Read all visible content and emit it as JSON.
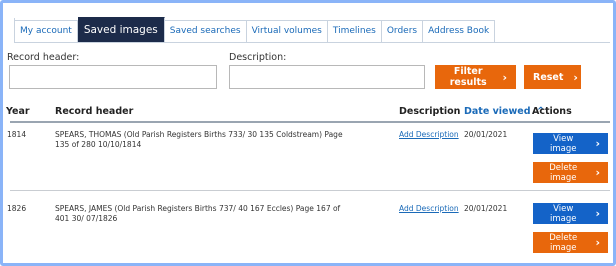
{
  "tabs": [
    {
      "label": "My account"
    },
    {
      "label": "Saved images",
      "active": true
    },
    {
      "label": "Saved searches"
    },
    {
      "label": "Virtual volumes"
    },
    {
      "label": "Timelines"
    },
    {
      "label": "Orders"
    },
    {
      "label": "Address Book"
    }
  ],
  "filters": {
    "record_header_label": "Record header:",
    "record_header_value": "",
    "description_label": "Description:",
    "description_value": "",
    "filter_label": "Filter results",
    "reset_label": "Reset"
  },
  "table": {
    "columns": {
      "year": "Year",
      "record_header": "Record header",
      "description": "Description",
      "date_viewed": "Date viewed",
      "actions": "Actions"
    },
    "sort_indicator": "^",
    "rows": [
      {
        "year": "1814",
        "record_header": "SPEARS, THOMAS (Old Parish Registers Births 733/  30 135 Coldstream) Page 135 of 280 10/10/1814",
        "description_link": "Add Description",
        "date_viewed": "20/01/2021",
        "view_label": "View image",
        "delete_label": "Delete image"
      },
      {
        "year": "1826",
        "record_header": "SPEARS, JAMES (Old Parish Registers Births 737/  40 167 Eccles) Page 167 of 401 30/ 07/1826",
        "description_link": "Add Description",
        "date_viewed": "20/01/2021",
        "view_label": "View image",
        "delete_label": "Delete image"
      }
    ]
  },
  "colors": {
    "accent_orange": "#e8670c",
    "accent_blue": "#1463c8",
    "active_tab": "#1c2b4a",
    "link": "#1a6ab8"
  },
  "icons": {
    "button_chevron": "chevron-right-icon",
    "sort": "sort-ascending-icon"
  }
}
